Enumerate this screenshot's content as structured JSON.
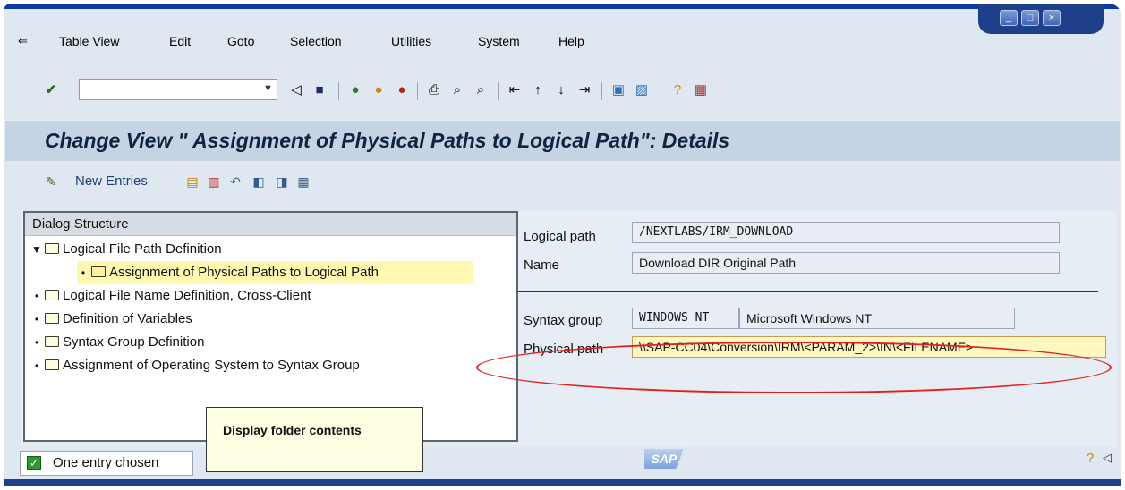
{
  "colors": {
    "window_bg": "#dfe7f1",
    "title_bar": "#c6d3e4",
    "selection_highlight": "#fff8b0",
    "annotation_ellipse": "#e12020"
  },
  "menu": [
    "Table View",
    "Edit",
    "Goto",
    "Selection",
    "Utilities",
    "System",
    "Help"
  ],
  "toolbar": {
    "command_field_value": "",
    "icons": [
      "enter-icon",
      "back-icon",
      "save-icon",
      "back-arrow-icon",
      "exit-icon",
      "cancel-icon",
      "print-icon",
      "find-icon",
      "find-next-icon",
      "first-page-icon",
      "prev-page-icon",
      "next-page-icon",
      "last-page-icon",
      "create-session-icon",
      "shortcut-icon",
      "help-icon",
      "layout-icon"
    ]
  },
  "title": "Change View \" Assignment of Physical Paths to Logical Path\": Details",
  "app_toolbar": {
    "new_entries": "New Entries"
  },
  "dialog_structure": {
    "header": "Dialog Structure",
    "items": [
      {
        "label": "Logical File Path Definition",
        "level": 0,
        "expanded": true
      },
      {
        "label": "Assignment of Physical Paths to Logical Path",
        "level": 1,
        "selected": true
      },
      {
        "label": "Logical File Name Definition, Cross-Client",
        "level": 0
      },
      {
        "label": "Definition of Variables",
        "level": 0
      },
      {
        "label": "Syntax Group Definition",
        "level": 0
      },
      {
        "label": "Assignment of Operating System to Syntax Group",
        "level": 0
      }
    ]
  },
  "details": {
    "logical_path_label": "Logical path",
    "logical_path_value": "/NEXTLABS/IRM_DOWNLOAD",
    "name_label": "Name",
    "name_value": "Download DIR Original Path",
    "syntax_group_label": "Syntax group",
    "syntax_group_value": "WINDOWS NT",
    "syntax_group_desc": "Microsoft Windows NT",
    "physical_path_label": "Physical path",
    "physical_path_value": "\\\\SAP-CC04\\Conversion\\IRM\\<PARAM_2>\\IN\\<FILENAME>"
  },
  "tooltip": "Display folder contents",
  "status": {
    "message": "One entry chosen",
    "logo": "SAP"
  }
}
